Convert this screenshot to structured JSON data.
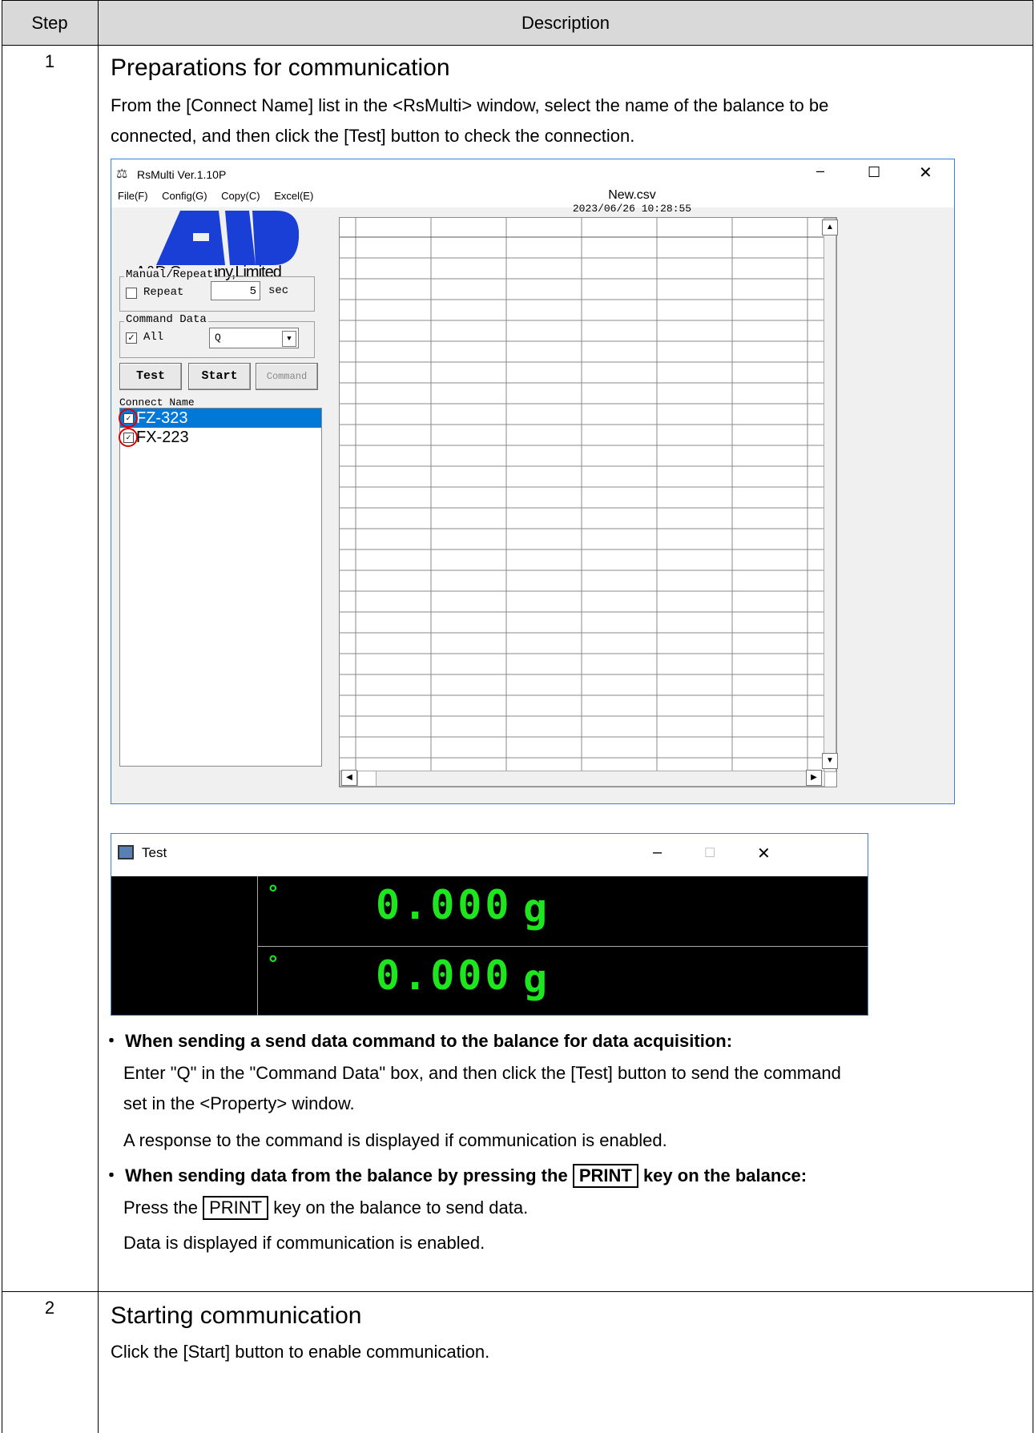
{
  "table": {
    "header_step": "Step",
    "header_description": "Description",
    "step1": {
      "number": "1",
      "title": "Preparations for communication",
      "intro_line1": "From the [Connect Name] list in the <RsMulti> window, select the name of the balance to be",
      "intro_line2": "connected, and then click the [Test] button to check the connection.",
      "bullet1_heading": "When sending a send data command to the balance for data acquisition:",
      "bullet1_line1": "Enter \"Q\" in the \"Command Data\" box, and then click the [Test] button to send the command",
      "bullet1_line2": "set in the <Property> window.",
      "bullet1_line3": "A response to the command is displayed if communication is enabled.",
      "bullet2_heading_pre": "When sending data from the balance by pressing the",
      "bullet2_key": "PRINT",
      "bullet2_heading_post": "key on the balance:",
      "bullet2_line1_pre": "Press the",
      "bullet2_line1_key": "PRINT",
      "bullet2_line1_post": "key on the balance to send data.",
      "bullet2_line2": "Data is displayed if communication is enabled.",
      "bullet_mark": "・"
    },
    "step2": {
      "number": "2",
      "title": "Starting communication",
      "line1": "Click the [Start] button to enable communication."
    }
  },
  "rsmulti": {
    "title": "RsMulti Ver.1.10P",
    "menu": [
      "File(F)",
      "Config(G)",
      "Copy(C)",
      "Excel(E)"
    ],
    "logo_text": "A&D Company,Limited",
    "manual_repeat_label": "Manual/Repeat",
    "repeat_label": "Repeat",
    "repeat_value": "5",
    "repeat_unit": "sec",
    "command_data_label": "Command Data",
    "all_label": "All",
    "command_value": "Q",
    "btn_test": "Test",
    "btn_start": "Start",
    "btn_command": "Command",
    "connect_name_label": "Connect Name",
    "connect_items": [
      "FZ-323",
      "FX-223"
    ],
    "file_name": "New.csv",
    "timestamp": "2023/06/26 10:28:55"
  },
  "testwin": {
    "title": "Test",
    "rows": [
      {
        "mark": "°",
        "value": "0.000",
        "unit": "g"
      },
      {
        "mark": "°",
        "value": "0.000",
        "unit": "g"
      }
    ]
  },
  "colors": {
    "header_bg": "#d9d9d9",
    "selection": "#0078d7",
    "display_green": "#1ee61e",
    "annotation_red": "#dd0000"
  }
}
